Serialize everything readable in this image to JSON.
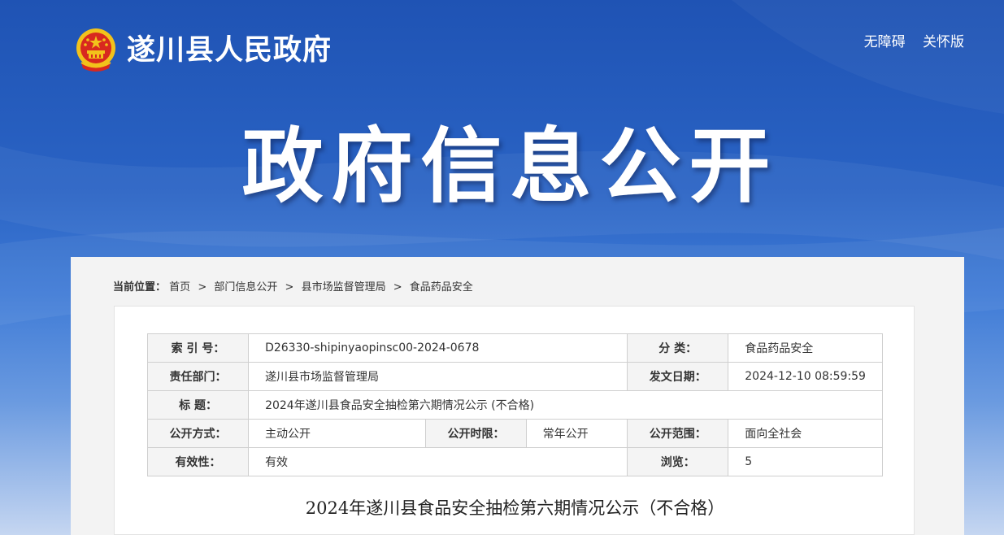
{
  "header": {
    "site_name": "遂川县人民政府",
    "links": [
      "无障碍",
      "关怀版"
    ]
  },
  "banner": {
    "title": "政府信息公开"
  },
  "breadcrumb": {
    "label": "当前位置：",
    "items": [
      "首页",
      "部门信息公开",
      "县市场监督管理局",
      "食品药品安全"
    ],
    "separator": ">"
  },
  "meta": {
    "index_no_label": "索 引 号：",
    "index_no": "D26330-shipinyaopinsc00-2024-0678",
    "category_label": "分    类：",
    "category": "食品药品安全",
    "dept_label": "责任部门：",
    "dept": "遂川县市场监督管理局",
    "date_label": "发文日期：",
    "date": "2024-12-10 08:59:59",
    "title_label": "标    题：",
    "title": "2024年遂川县食品安全抽检第六期情况公示 (不合格)",
    "method_label": "公开方式：",
    "method": "主动公开",
    "period_label": "公开时限：",
    "period": "常年公开",
    "scope_label": "公开范围：",
    "scope": "面向全社会",
    "validity_label": "有效性：",
    "validity": "有效",
    "views_label": "浏览：",
    "views": "5"
  },
  "article": {
    "title": "2024年遂川县食品安全抽检第六期情况公示（不合格）"
  },
  "colors": {
    "banner_blue": "#1f53b4",
    "emblem_red": "#d8281f",
    "emblem_gold": "#f2c21b"
  }
}
